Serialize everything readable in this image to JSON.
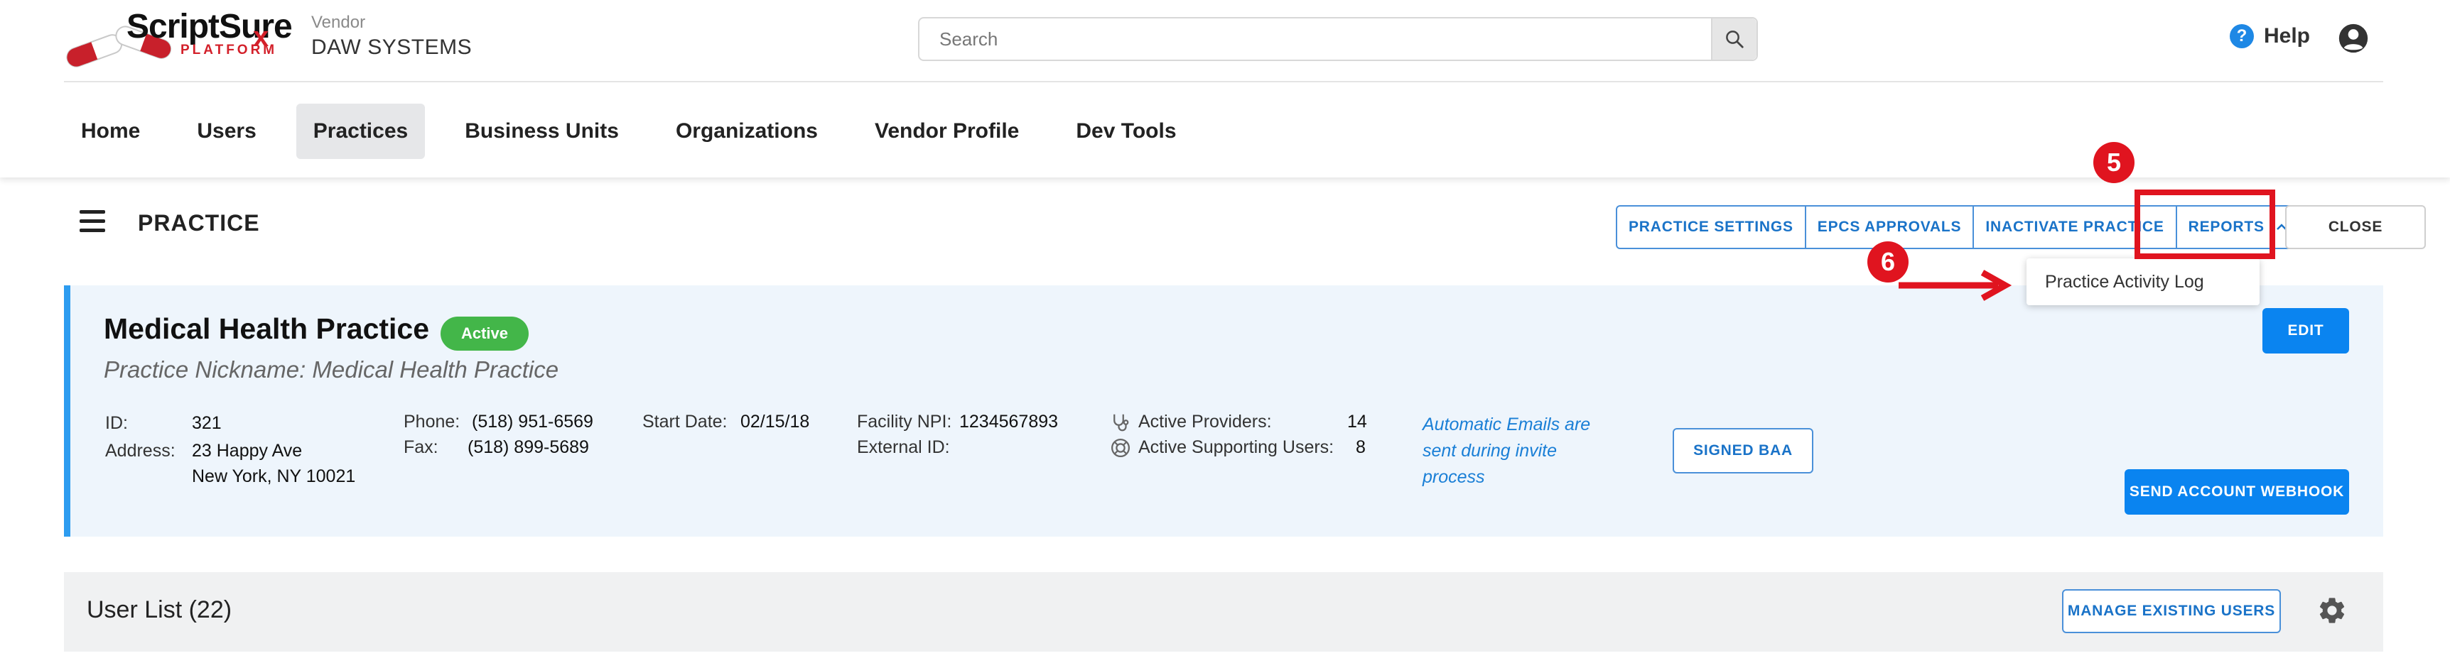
{
  "header": {
    "logo_text": "ScriptSure",
    "logo_rx": "x",
    "logo_sub": "PLATFORM",
    "vendor_label": "Vendor",
    "vendor_name": "DAW SYSTEMS",
    "search_placeholder": "Search",
    "help_label": "Help"
  },
  "nav": {
    "items": [
      {
        "label": "Home",
        "active": false
      },
      {
        "label": "Users",
        "active": false
      },
      {
        "label": "Practices",
        "active": true
      },
      {
        "label": "Business Units",
        "active": false
      },
      {
        "label": "Organizations",
        "active": false
      },
      {
        "label": "Vendor Profile",
        "active": false
      },
      {
        "label": "Dev Tools",
        "active": false
      }
    ]
  },
  "page": {
    "title": "PRACTICE",
    "actions": {
      "practice_settings": "PRACTICE SETTINGS",
      "epcs_approvals": "EPCS APPROVALS",
      "inactivate_practice": "INACTIVATE PRACTICE",
      "reports": "REPORTS",
      "close": "CLOSE"
    },
    "reports_menu": [
      "Practice Activity Log"
    ]
  },
  "annotations": {
    "step5": "5",
    "step6": "6"
  },
  "practice": {
    "name": "Medical Health Practice",
    "status": "Active",
    "nickname": "Practice Nickname: Medical Health Practice",
    "id_label": "ID:",
    "id": "321",
    "address_label": "Address:",
    "address_line1": "23 Happy Ave",
    "address_line2": "New York, NY 10021",
    "phone_label": "Phone:",
    "phone": "(518) 951-6569",
    "fax_label": "Fax:",
    "fax": "(518) 899-5689",
    "start_date_label": "Start Date:",
    "start_date": "02/15/18",
    "facility_npi_label": "Facility NPI:",
    "facility_npi": "1234567893",
    "external_id_label": "External ID:",
    "external_id": "",
    "active_providers_label": "Active Providers:",
    "active_providers": "14",
    "active_supporting_label": "Active Supporting Users:",
    "active_supporting": "8",
    "email_note": "Automatic Emails are sent during invite process",
    "signed_baa": "SIGNED BAA",
    "edit": "EDIT",
    "send_webhook": "SEND ACCOUNT WEBHOOK"
  },
  "user_list": {
    "title": "User List (22)",
    "manage_button": "MANAGE EXISTING USERS"
  },
  "colors": {
    "accent": "#0a84f0",
    "annotation_red": "#e0141f",
    "status_green": "#43b649"
  }
}
